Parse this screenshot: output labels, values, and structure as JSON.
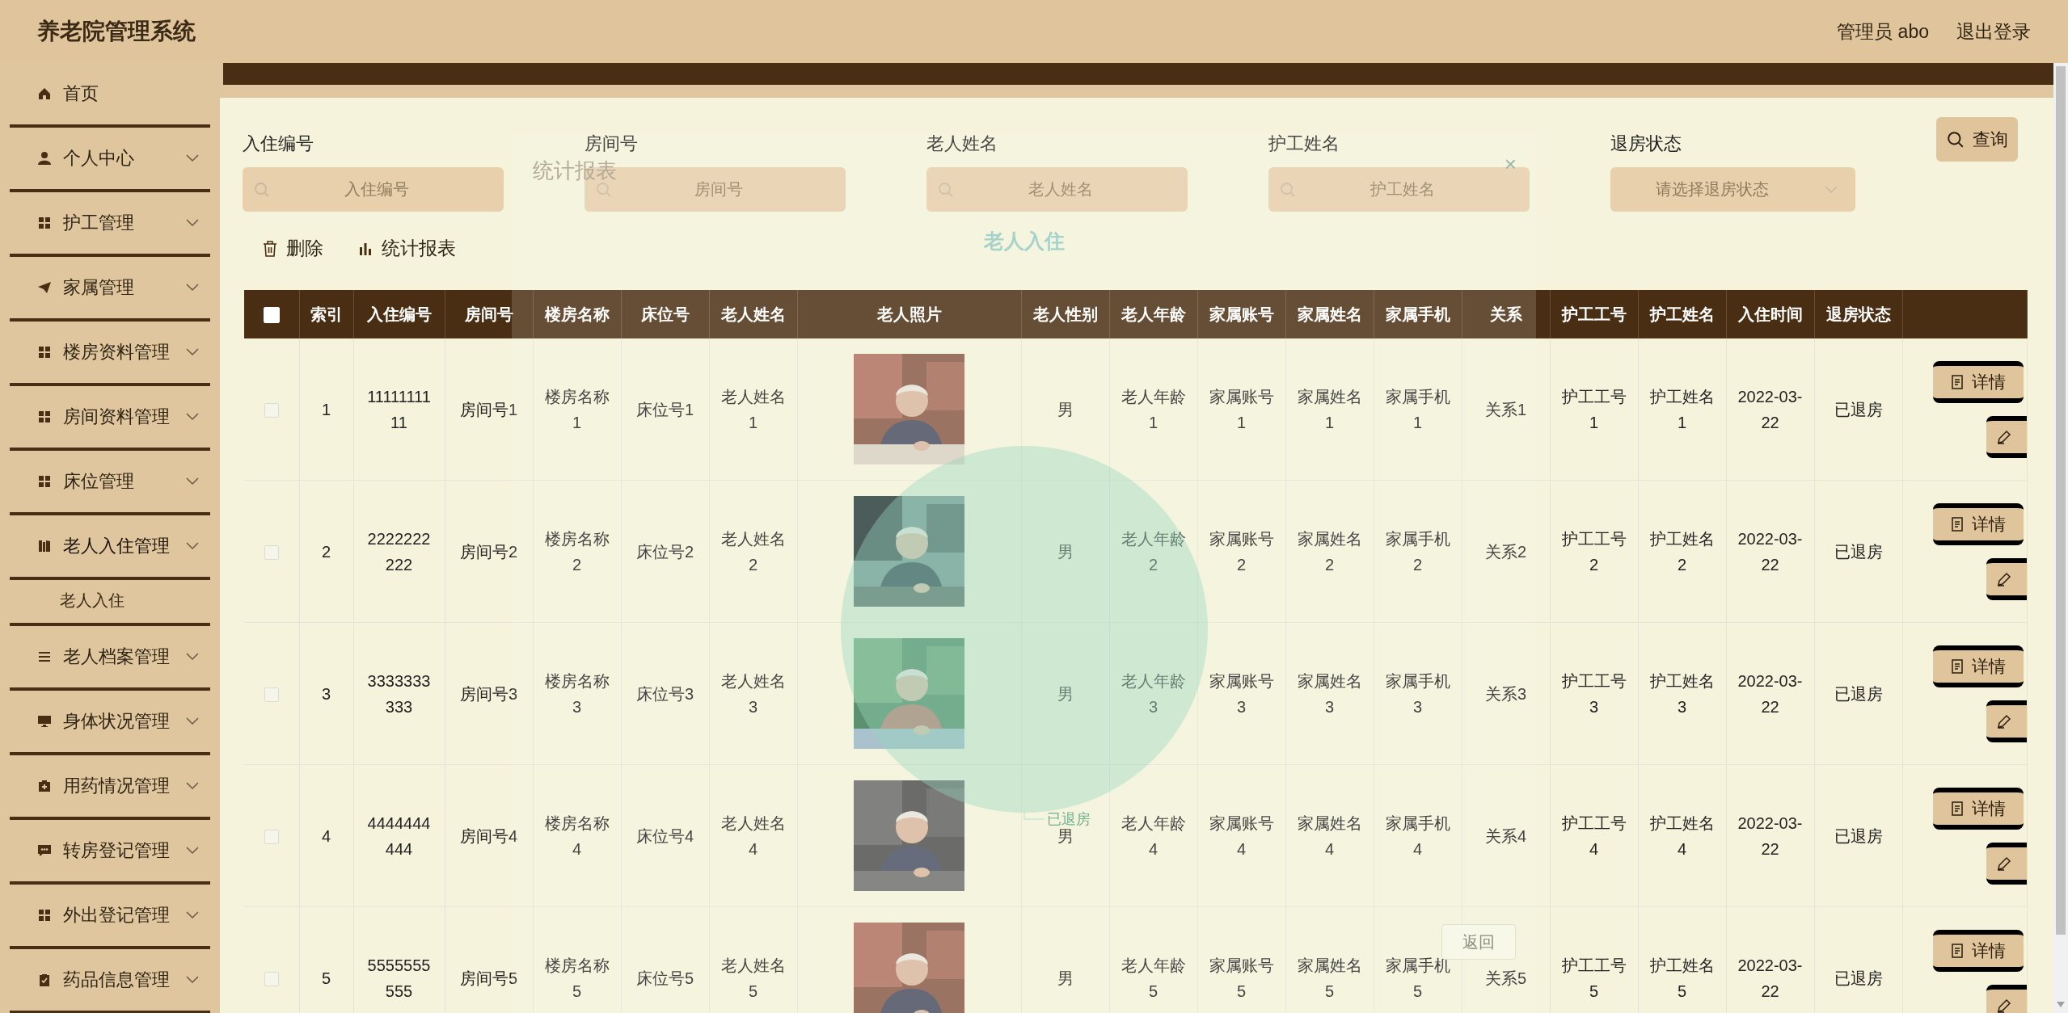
{
  "header": {
    "title": "养老院管理系统",
    "user": "管理员 abo",
    "logout": "退出登录"
  },
  "sidebar": {
    "items": [
      {
        "label": "首页",
        "kind": "link",
        "expanded": false
      },
      {
        "label": "个人中心",
        "kind": "menu",
        "expanded": false
      },
      {
        "label": "护工管理",
        "kind": "menu",
        "expanded": false
      },
      {
        "label": "家属管理",
        "kind": "menu",
        "expanded": false
      },
      {
        "label": "楼房资料管理",
        "kind": "menu",
        "expanded": false
      },
      {
        "label": "房间资料管理",
        "kind": "menu",
        "expanded": false
      },
      {
        "label": "床位管理",
        "kind": "menu",
        "expanded": false
      },
      {
        "label": "老人入住管理",
        "kind": "menu",
        "expanded": true,
        "children": [
          {
            "label": "老人入住"
          }
        ]
      },
      {
        "label": "老人档案管理",
        "kind": "menu",
        "expanded": false
      },
      {
        "label": "身体状况管理",
        "kind": "menu",
        "expanded": false
      },
      {
        "label": "用药情况管理",
        "kind": "menu",
        "expanded": false
      },
      {
        "label": "转房登记管理",
        "kind": "menu",
        "expanded": false
      },
      {
        "label": "外出登记管理",
        "kind": "menu",
        "expanded": false
      },
      {
        "label": "药品信息管理",
        "kind": "menu",
        "expanded": false
      }
    ]
  },
  "search": {
    "fields": [
      {
        "label": "入住编号",
        "placeholder": "入住编号",
        "kind": "text"
      },
      {
        "label": "房间号",
        "placeholder": "房间号",
        "kind": "text"
      },
      {
        "label": "老人姓名",
        "placeholder": "老人姓名",
        "kind": "text"
      },
      {
        "label": "护工姓名",
        "placeholder": "护工姓名",
        "kind": "text"
      },
      {
        "label": "退房状态",
        "placeholder": "请选择退房状态",
        "kind": "select"
      }
    ],
    "query_button": "查询"
  },
  "actions": [
    {
      "label": "删除"
    },
    {
      "label": "统计报表"
    }
  ],
  "table": {
    "select_all": {
      "checked": false
    },
    "columns": [
      "索引",
      "入住编号",
      "房间号",
      "楼房名称",
      "床位号",
      "老人姓名",
      "老人照片",
      "老人性别",
      "老人年龄",
      "家属账号",
      "家属姓名",
      "家属手机",
      "关系",
      "护工工号",
      "护工姓名",
      "入住时间",
      "退房状态"
    ],
    "rows": [
      {
        "checked": false,
        "cells": [
          "1",
          "1111111111",
          "房间号1",
          "楼房名称1",
          "床位号1",
          "老人姓名1",
          {
            "kind": "picture"
          },
          "男",
          "老人年龄1",
          "家属账号1",
          "家属姓名1",
          "家属手机1",
          "关系1",
          "护工工号1",
          "护工姓名1",
          "2022-03-22",
          "已退房"
        ],
        "detail_button": "详情"
      },
      {
        "checked": false,
        "cells": [
          "2",
          "2222222222",
          "房间号2",
          "楼房名称2",
          "床位号2",
          "老人姓名2",
          {
            "kind": "picture"
          },
          "男",
          "老人年龄2",
          "家属账号2",
          "家属姓名2",
          "家属手机2",
          "关系2",
          "护工工号2",
          "护工姓名2",
          "2022-03-22",
          "已退房"
        ],
        "detail_button": "详情"
      },
      {
        "checked": false,
        "cells": [
          "3",
          "3333333333",
          "房间号3",
          "楼房名称3",
          "床位号3",
          "老人姓名3",
          {
            "kind": "picture"
          },
          "男",
          "老人年龄3",
          "家属账号3",
          "家属姓名3",
          "家属手机3",
          "关系3",
          "护工工号3",
          "护工姓名3",
          "2022-03-22",
          "已退房"
        ],
        "detail_button": "详情"
      },
      {
        "checked": false,
        "cells": [
          "4",
          "4444444444",
          "房间号4",
          "楼房名称4",
          "床位号4",
          "老人姓名4",
          {
            "kind": "picture"
          },
          "男",
          "老人年龄4",
          "家属账号4",
          "家属姓名4",
          "家属手机4",
          "关系4",
          "护工工号4",
          "护工姓名4",
          "2022-03-22",
          "已退房"
        ],
        "detail_button": "详情"
      },
      {
        "checked": false,
        "cells": [
          "5",
          "5555555555",
          "房间号5",
          "楼房名称5",
          "床位号5",
          "老人姓名5",
          {
            "kind": "picture"
          },
          "男",
          "老人年龄5",
          "家属账号5",
          "家属姓名5",
          "家属手机5",
          "关系5",
          "护工工号5",
          "护工姓名5",
          "2022-03-22",
          "已退房"
        ],
        "detail_button": "详情"
      }
    ]
  },
  "dialog": {
    "title": "统计报表",
    "close": "×",
    "chart_title": "老人入住",
    "legend_label": "已退房",
    "back_button": "返回"
  }
}
